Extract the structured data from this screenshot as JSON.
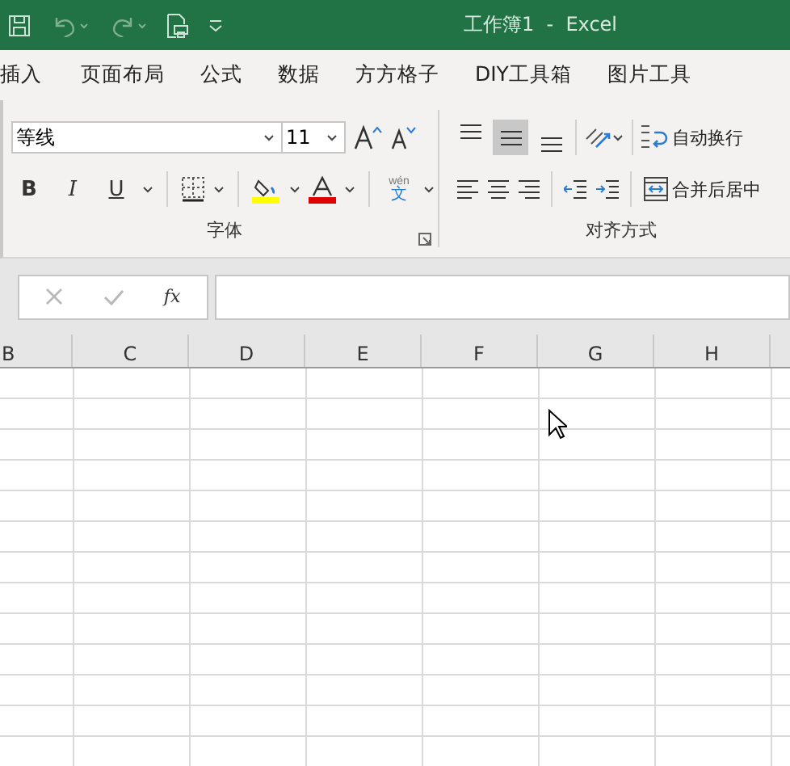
{
  "title_bar": {
    "title": "工作簿1  -  Excel"
  },
  "tabs": [
    {
      "label": "插入",
      "selected": false
    },
    {
      "label": "页面布局",
      "selected": false
    },
    {
      "label": "公式",
      "selected": false
    },
    {
      "label": "数据",
      "selected": false
    },
    {
      "label": "方方格子",
      "selected": false
    },
    {
      "label": "DIY工具箱",
      "selected": false
    },
    {
      "label": "图片工具",
      "selected": false
    }
  ],
  "font_group": {
    "font_name": "等线",
    "font_size": "11",
    "bold": "B",
    "italic": "I",
    "underline": "U",
    "phonetic_top": "wén",
    "phonetic_bottom": "文",
    "label": "字体"
  },
  "alignment_group": {
    "vertical": [
      {
        "kind": "top",
        "selected": false
      },
      {
        "kind": "middle",
        "selected": true
      },
      {
        "kind": "bottom",
        "selected": false
      }
    ],
    "wrap_text": "自动换行",
    "merge_center": "合并后居中",
    "label": "对齐方式"
  },
  "formula_bar": {
    "fx": "fx"
  },
  "columns": [
    "B",
    "C",
    "D",
    "E",
    "F",
    "G",
    "H"
  ]
}
